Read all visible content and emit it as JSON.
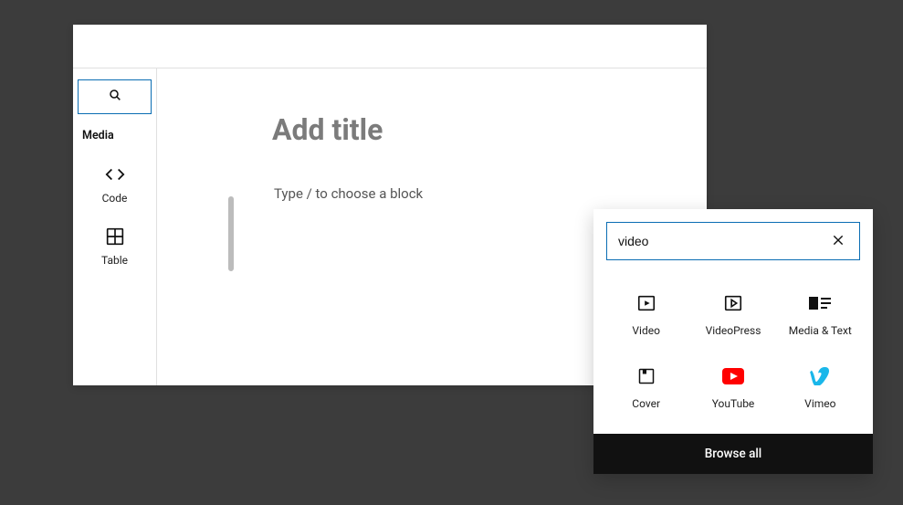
{
  "sidebar": {
    "section_label": "Media",
    "blocks": [
      {
        "label": "Code"
      },
      {
        "label": "Table"
      }
    ]
  },
  "editor": {
    "title_placeholder": "Add title",
    "body_placeholder": "Type / to choose a block"
  },
  "inserter": {
    "search_value": "video",
    "results": [
      {
        "label": "Video"
      },
      {
        "label": "VideoPress"
      },
      {
        "label": "Media & Text"
      },
      {
        "label": "Cover"
      },
      {
        "label": "YouTube"
      },
      {
        "label": "Vimeo"
      }
    ],
    "browse_all_label": "Browse all"
  }
}
